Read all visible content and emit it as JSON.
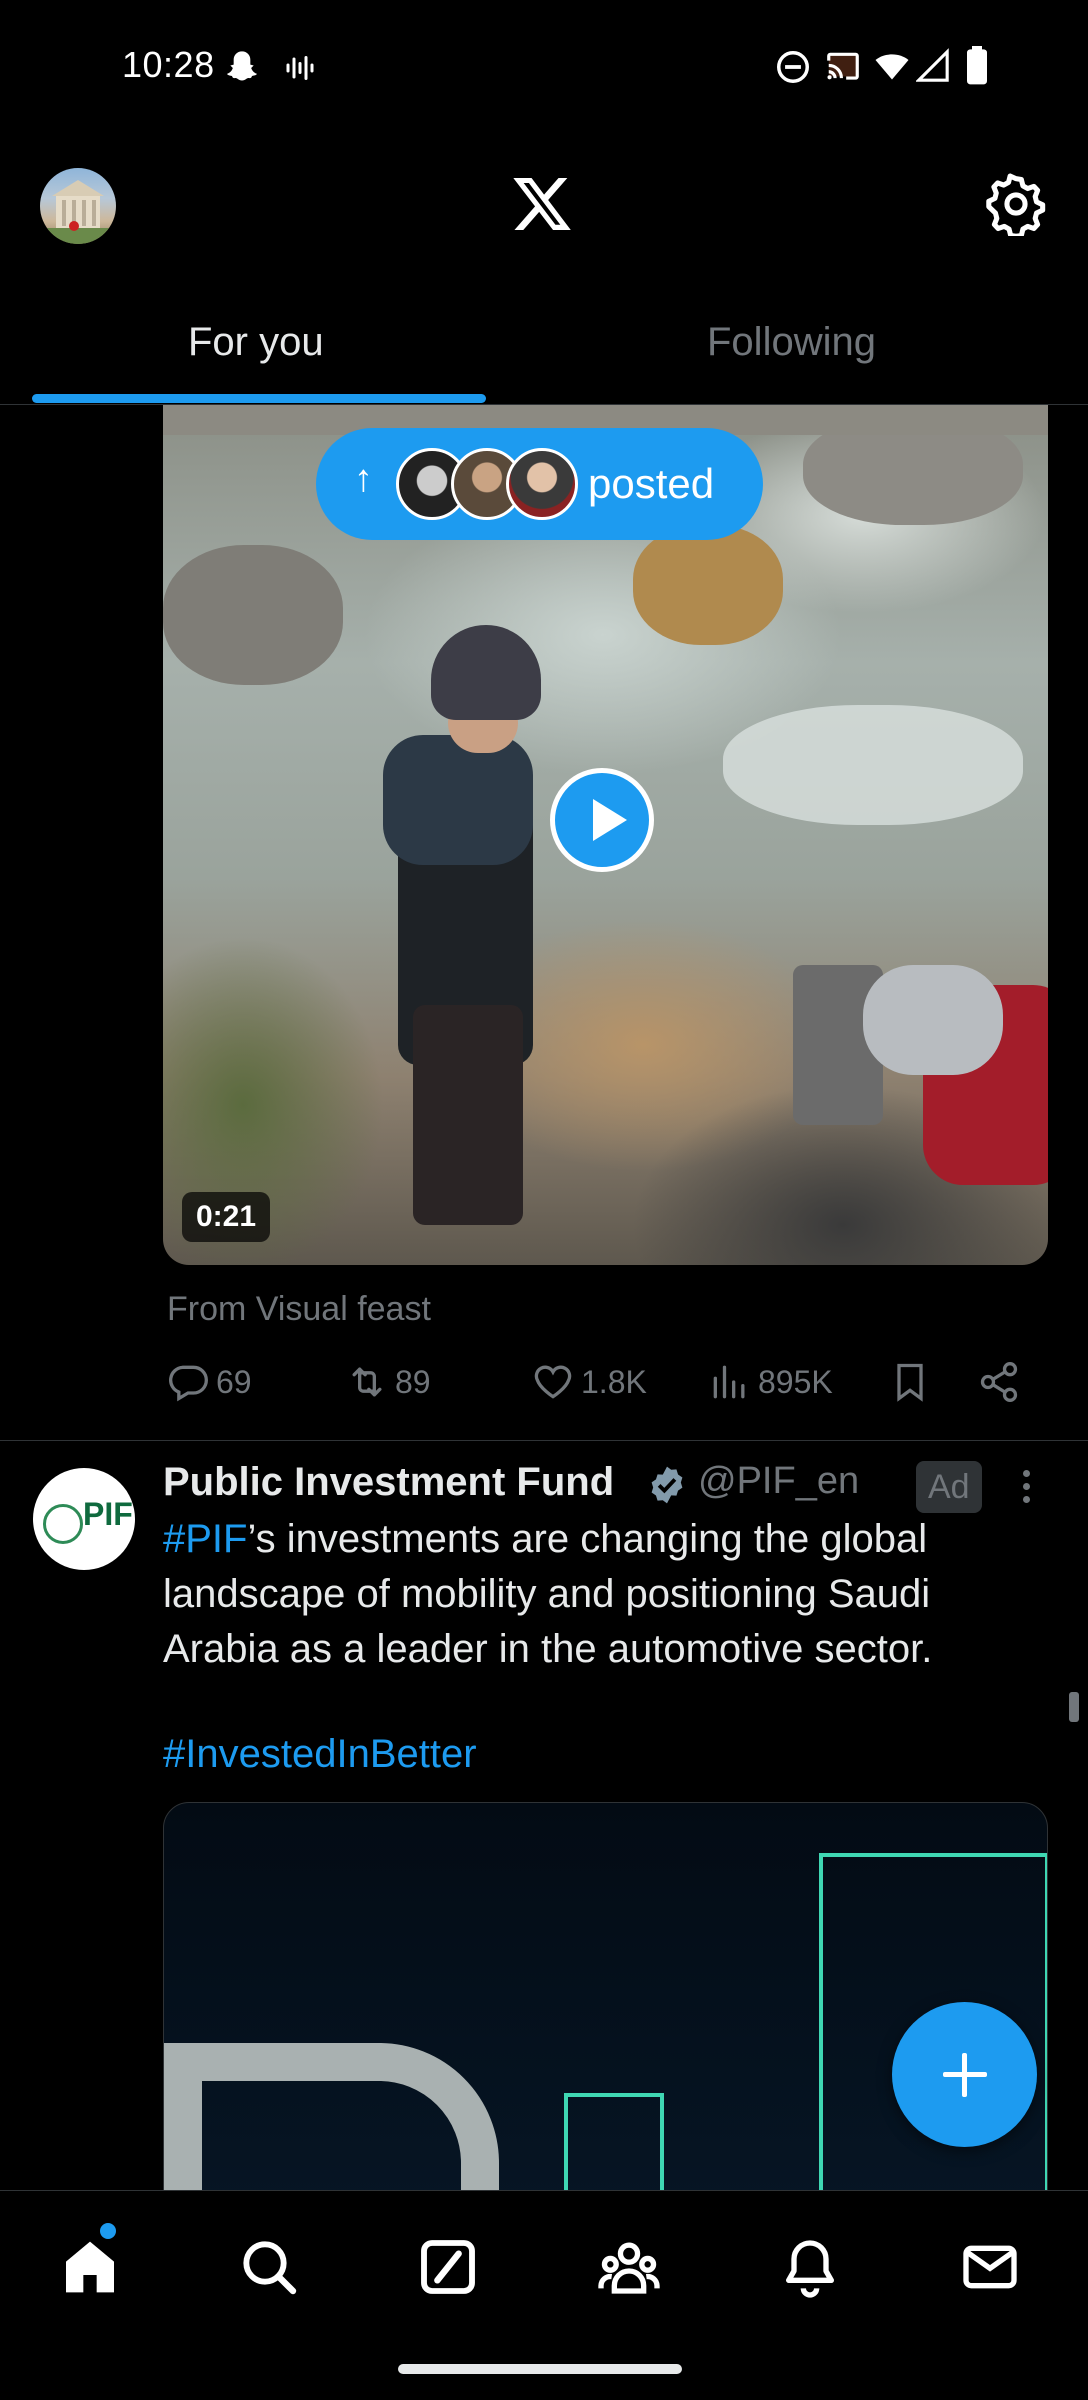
{
  "status_bar": {
    "time": "10:28",
    "icons": [
      "snapchat-icon",
      "voicemail-icon",
      "do-not-disturb-icon",
      "cast-icon",
      "wifi-icon",
      "signal-icon",
      "battery-icon"
    ]
  },
  "header": {
    "logo": "x-logo-icon",
    "settings_icon": "gear-icon"
  },
  "tabs": [
    {
      "label": "For you",
      "active": true
    },
    {
      "label": "Following",
      "active": false
    }
  ],
  "tweet1": {
    "posted_pill": {
      "arrow": "↑",
      "text": "posted"
    },
    "video_duration": "0:21",
    "source_label": "From Visual feast",
    "actions": {
      "replies": "69",
      "reposts": "89",
      "likes": "1.8K",
      "views": "895K"
    }
  },
  "tweet2": {
    "avatar_text": "PIF",
    "name": "Public Investment Fund",
    "handle": "@PIF_en",
    "ad_label": "Ad",
    "body_hashtag1": "#PIF",
    "body_text": "’s investments are changing the global landscape of mobility and positioning Saudi Arabia as a leader in the automotive sector.",
    "body_hashtag2": "#InvestedInBetter"
  },
  "bottom_nav": {
    "items": [
      "home-icon",
      "search-icon",
      "grok-icon",
      "communities-icon",
      "notifications-icon",
      "messages-icon"
    ]
  },
  "colors": {
    "accent": "#1d9bf0",
    "background": "#000000",
    "text_primary": "#e7e9ea",
    "text_secondary": "#71767b"
  }
}
